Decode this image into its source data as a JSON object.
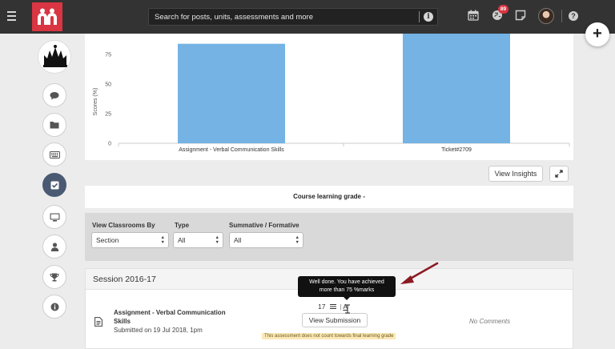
{
  "search": {
    "placeholder": "Search for posts, units, assessments and more"
  },
  "header": {
    "notification_count": "89"
  },
  "chart_data": {
    "type": "bar",
    "categories": [
      "Assignment - Verbal Communication Skills",
      "Ticket#2709"
    ],
    "values": [
      84,
      100
    ],
    "ylabel": "Scores (%)",
    "yticks": [
      0,
      25,
      50,
      75
    ],
    "ylim": [
      0,
      100
    ],
    "bar_color": "#74b3e4"
  },
  "actions": {
    "view_insights": "View Insights"
  },
  "grade": {
    "label": "Course learning grade -"
  },
  "filters": {
    "classrooms_label": "View Classrooms By",
    "classrooms_value": "Section",
    "type_label": "Type",
    "type_value": "All",
    "summative_label": "Summative / Formative",
    "summative_value": "All"
  },
  "session": {
    "title": "Session 2016-17",
    "assignment": {
      "title": "Assignment - Verbal Communication Skills",
      "submitted": "Submitted on 19 Jul 2018, 1pm",
      "score": "17",
      "grade": "A",
      "view_button": "View Submission",
      "note": "This assessment does not count towards final learning grade",
      "comments": "No Comments"
    }
  },
  "tooltip": {
    "line1": "Well done. You have achieved",
    "line2": "more than 75 %marks"
  },
  "colors": {
    "topbar": "#333333",
    "brand": "#d93542",
    "rail_active": "#4b5a73",
    "annotation_arrow": "#8b1a22"
  }
}
